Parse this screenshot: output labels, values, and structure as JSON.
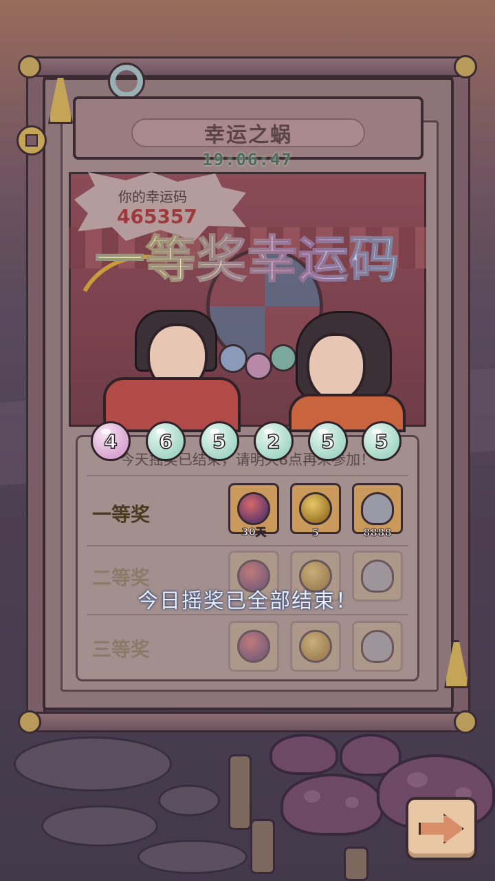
{
  "header": {
    "title": "幸运之蜗",
    "timer": "19:06:47"
  },
  "lucky": {
    "label": "你的幸运码",
    "code": "465357"
  },
  "banner": {
    "text": "一等奖幸运码"
  },
  "numbers": [
    "4",
    "6",
    "5",
    "2",
    "5",
    "5"
  ],
  "notice": "今天摇奖已结束，请明天8点再来参加！",
  "tiers": [
    {
      "label": "一等奖",
      "rewards": [
        {
          "icon": "crystal-ball-icon",
          "count": "30天"
        },
        {
          "icon": "yin-yang-coin-icon",
          "count": "5"
        },
        {
          "icon": "ghost-icon",
          "count": "8888"
        }
      ]
    },
    {
      "label": "二等奖",
      "rewards": [
        {
          "icon": "crystal-ball-icon",
          "count": ""
        },
        {
          "icon": "yin-yang-coin-icon",
          "count": ""
        },
        {
          "icon": "ghost-icon",
          "count": ""
        }
      ]
    },
    {
      "label": "三等奖",
      "rewards": [
        {
          "icon": "crystal-ball-icon",
          "count": ""
        },
        {
          "icon": "yin-yang-coin-icon",
          "count": ""
        },
        {
          "icon": "ghost-icon",
          "count": ""
        }
      ]
    }
  ],
  "toast": "今日摇奖已全部结束！",
  "next_button": {
    "icon": "arrow-right-icon"
  },
  "colors": {
    "ball_first": "#d8a6d0",
    "ball_rest": "#a6d8c8",
    "toast_text": "#e6f0ff"
  }
}
